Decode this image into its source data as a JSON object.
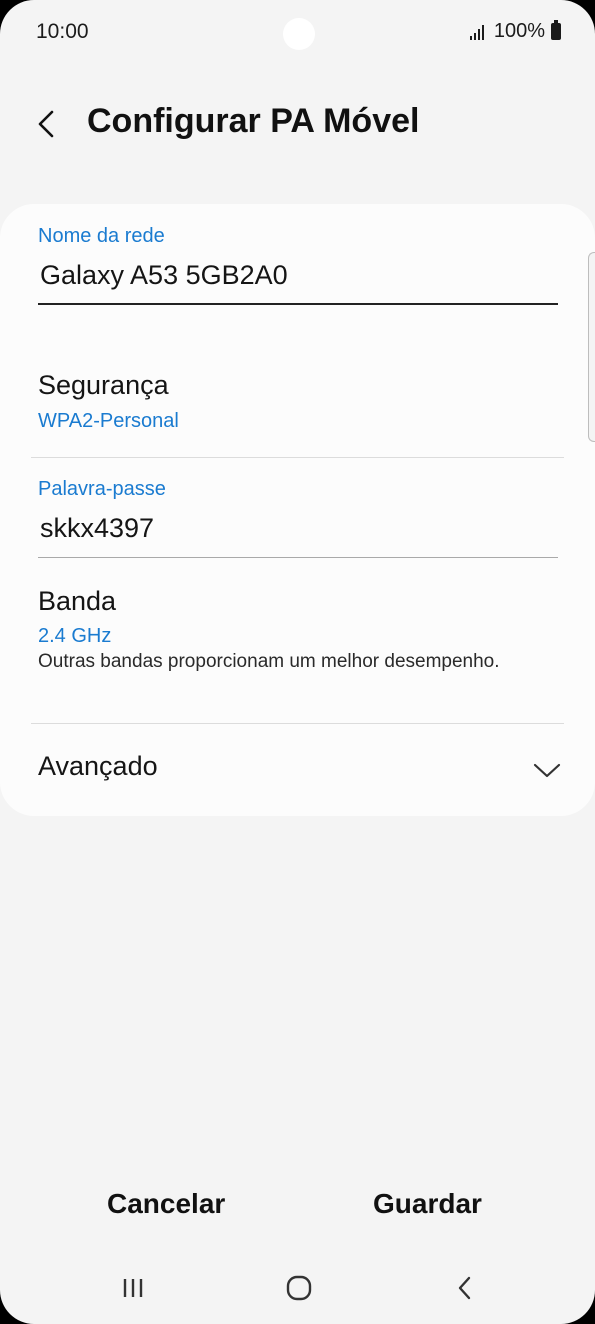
{
  "status_bar": {
    "time": "10:00",
    "battery": "100%"
  },
  "header": {
    "title": "Configurar PA Móvel"
  },
  "form": {
    "network_name": {
      "label": "Nome da rede",
      "value": "Galaxy A53 5GB2A0"
    },
    "security": {
      "title": "Segurança",
      "value": "WPA2-Personal"
    },
    "password": {
      "label": "Palavra-passe",
      "value": "skkx4397"
    },
    "band": {
      "title": "Banda",
      "value": "2.4 GHz",
      "description": "Outras bandas proporcionam um melhor desempenho."
    },
    "advanced": {
      "title": "Avançado"
    }
  },
  "actions": {
    "cancel_label": "Cancelar",
    "save_label": "Guardar"
  },
  "colors": {
    "accent": "#1a7bd0",
    "background": "#f4f4f4",
    "card": "#fcfcfc"
  },
  "icons": {
    "back": "back-arrow-icon",
    "chevron": "chevron-down-icon",
    "nav_recents": "recents-icon",
    "nav_home": "home-icon",
    "nav_back": "nav-back-icon"
  }
}
